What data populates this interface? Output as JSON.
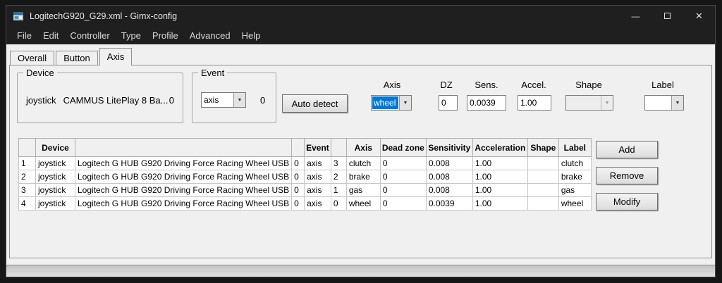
{
  "window": {
    "title": "LogitechG920_G29.xml - Gimx-config"
  },
  "icons": {
    "minimize": "—",
    "close": "✕",
    "dropdown": "▼"
  },
  "menu": {
    "items": [
      "File",
      "Edit",
      "Controller",
      "Type",
      "Profile",
      "Advanced",
      "Help"
    ]
  },
  "tabs": [
    {
      "label": "Overall"
    },
    {
      "label": "Button"
    },
    {
      "label": "Axis"
    }
  ],
  "controls": {
    "device_group": {
      "legend": "Device",
      "type": "joystick",
      "name": "CAMMUS LitePlay 8 Ba...",
      "id": "0"
    },
    "event_group": {
      "legend": "Event",
      "type": "axis",
      "id": "0"
    },
    "auto_detect": "Auto detect",
    "axis": {
      "label": "Axis",
      "value": "wheel"
    },
    "dz": {
      "label": "DZ",
      "value": "0"
    },
    "sens": {
      "label": "Sens.",
      "value": "0.0039"
    },
    "accel": {
      "label": "Accel.",
      "value": "1.00"
    },
    "shape": {
      "label": "Shape",
      "value": ""
    },
    "label": {
      "label": "Label",
      "value": ""
    }
  },
  "table": {
    "headers": [
      "",
      "Device",
      "",
      "",
      "Event",
      "",
      "Axis",
      "Dead zone",
      "Sensitivity",
      "Acceleration",
      "Shape",
      "Label"
    ],
    "rows": [
      [
        "1",
        "joystick",
        "Logitech G HUB G920 Driving Force Racing Wheel USB",
        "0",
        "axis",
        "3",
        "clutch",
        "0",
        "0.008",
        "1.00",
        "",
        "clutch"
      ],
      [
        "2",
        "joystick",
        "Logitech G HUB G920 Driving Force Racing Wheel USB",
        "0",
        "axis",
        "2",
        "brake",
        "0",
        "0.008",
        "1.00",
        "",
        "brake"
      ],
      [
        "3",
        "joystick",
        "Logitech G HUB G920 Driving Force Racing Wheel USB",
        "0",
        "axis",
        "1",
        "gas",
        "0",
        "0.008",
        "1.00",
        "",
        "gas"
      ],
      [
        "4",
        "joystick",
        "Logitech G HUB G920 Driving Force Racing Wheel USB",
        "0",
        "axis",
        "0",
        "wheel",
        "0",
        "0.0039",
        "1.00",
        "",
        "wheel"
      ]
    ]
  },
  "actions": {
    "add": "Add",
    "remove": "Remove",
    "modify": "Modify"
  },
  "colors": {
    "selection": "#0078d7",
    "window_bg": "#f0f0f0",
    "titlebar_bg": "#1f1f1f",
    "desktop_bg": "#161616"
  }
}
